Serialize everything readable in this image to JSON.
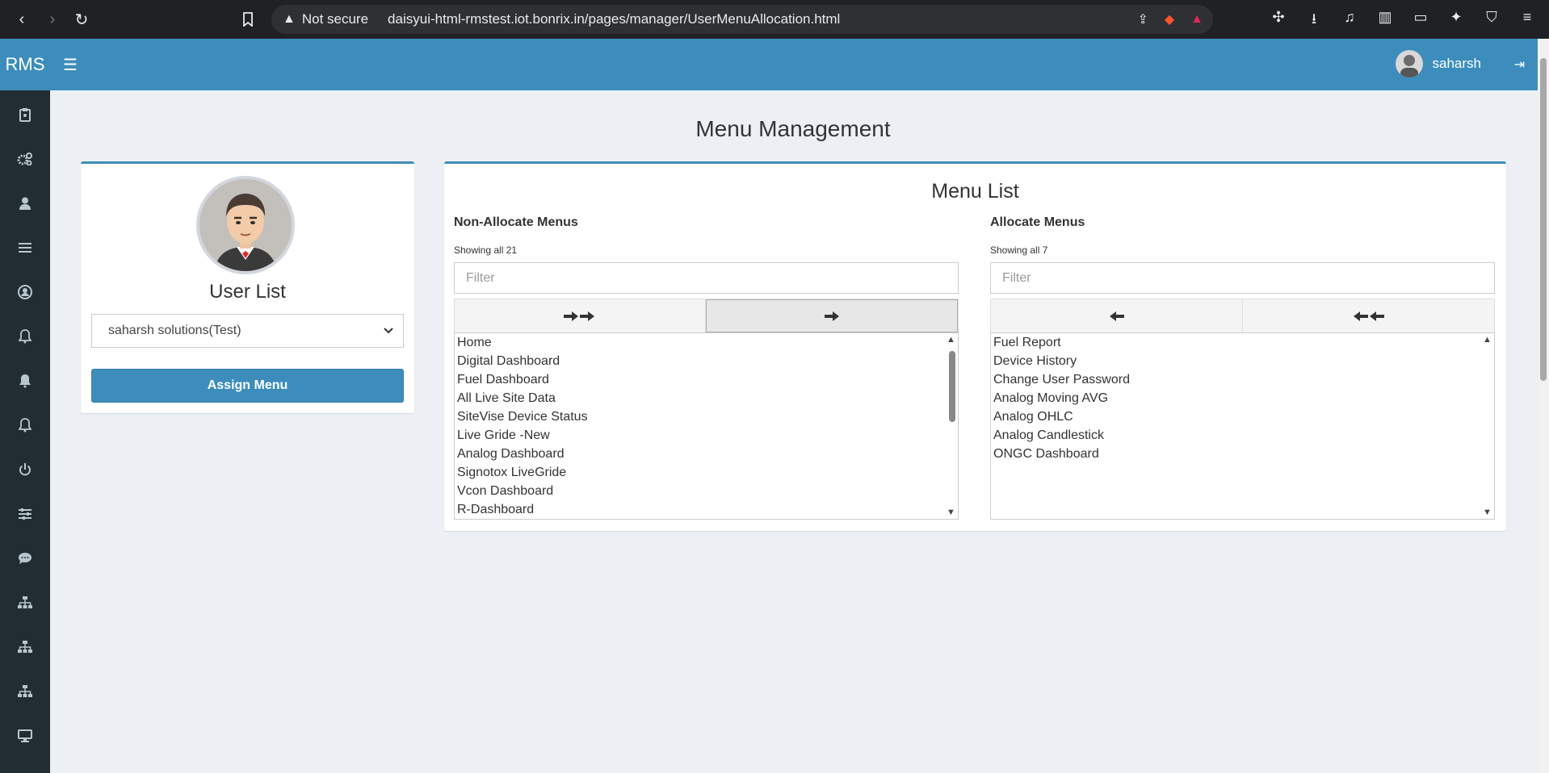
{
  "browser": {
    "not_secure": "Not secure",
    "url": "daisyui-html-rmstest.iot.bonrix.in/pages/manager/UserMenuAllocation.html"
  },
  "header": {
    "logo": "RMS",
    "username": "saharsh"
  },
  "sidebar": {
    "icons": [
      "clipboard-icon",
      "gears-icon",
      "user-icon",
      "list-icon",
      "user-circle-icon",
      "bell-outline-icon",
      "bell-icon",
      "bell-outline-icon",
      "power-icon",
      "sliders-icon",
      "comment-icon",
      "sitemap-icon",
      "sitemap-icon",
      "sitemap-icon",
      "desktop-icon"
    ]
  },
  "page": {
    "title": "Menu Management"
  },
  "user_panel": {
    "title": "User List",
    "selected_user": "saharsh solutions(Test)",
    "assign_label": "Assign Menu"
  },
  "menu_panel": {
    "title": "Menu List",
    "non_allocated": {
      "heading": "Non-Allocate Menus",
      "showing": "Showing all 21",
      "filter_placeholder": "Filter",
      "items": [
        "Home",
        "Digital Dashboard",
        "Fuel Dashboard",
        "All Live Site Data",
        "SiteVise Device Status",
        "Live Gride -New",
        "Analog Dashboard",
        "Signotox LiveGride",
        "Vcon Dashboard",
        "R-Dashboard"
      ]
    },
    "allocated": {
      "heading": "Allocate Menus",
      "showing": "Showing all 7",
      "filter_placeholder": "Filter",
      "items": [
        "Fuel Report",
        "Device History",
        "Change User Password",
        "Analog Moving AVG",
        "Analog OHLC",
        "Analog Candlestick",
        "ONGC Dashboard"
      ]
    }
  }
}
